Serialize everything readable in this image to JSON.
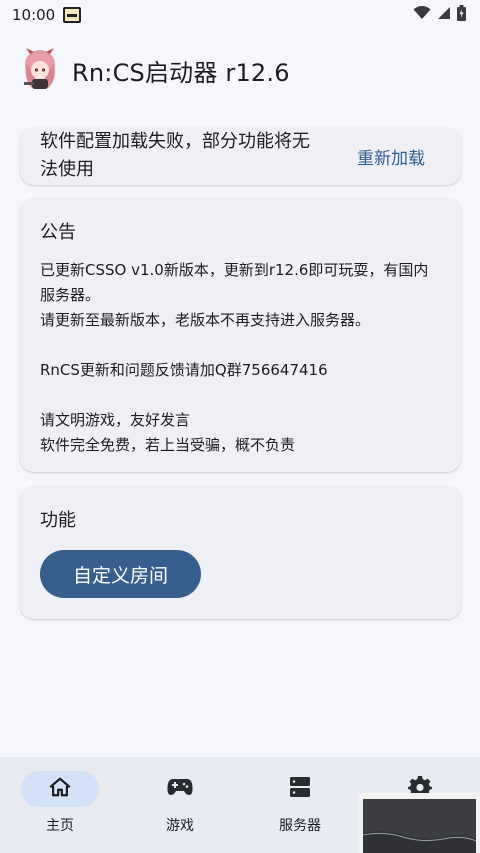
{
  "status_bar": {
    "time": "10:00"
  },
  "header": {
    "title": "Rn:CS启动器 r12.6"
  },
  "error_card": {
    "message": "软件配置加载失败，部分功能将无法使用",
    "reload_label": "重新加载"
  },
  "announcement": {
    "title": "公告",
    "lines": [
      "已更新CSSO v1.0新版本，更新到r12.6即可玩耍，有国内服务器。",
      "请更新至最新版本，老版本不再支持进入服务器。",
      "",
      "RnCS更新和问题反馈请加Q群756647416",
      "",
      "请文明游戏，友好发言",
      "软件完全免费，若上当受骗，概不负责"
    ]
  },
  "features": {
    "title": "功能",
    "custom_room_label": "自定义房间"
  },
  "bottom_nav": {
    "items": [
      {
        "label": "主页",
        "icon": "home-icon",
        "active": true
      },
      {
        "label": "游戏",
        "icon": "gamepad-icon",
        "active": false
      },
      {
        "label": "服务器",
        "icon": "server-icon",
        "active": false
      },
      {
        "label": "",
        "icon": "gear-icon",
        "active": false
      }
    ]
  },
  "colors": {
    "accent": "#365f8d",
    "link": "#2f5f8f",
    "nav_active_bg": "#d3e2f6",
    "card_bg": "#eff0f6"
  }
}
